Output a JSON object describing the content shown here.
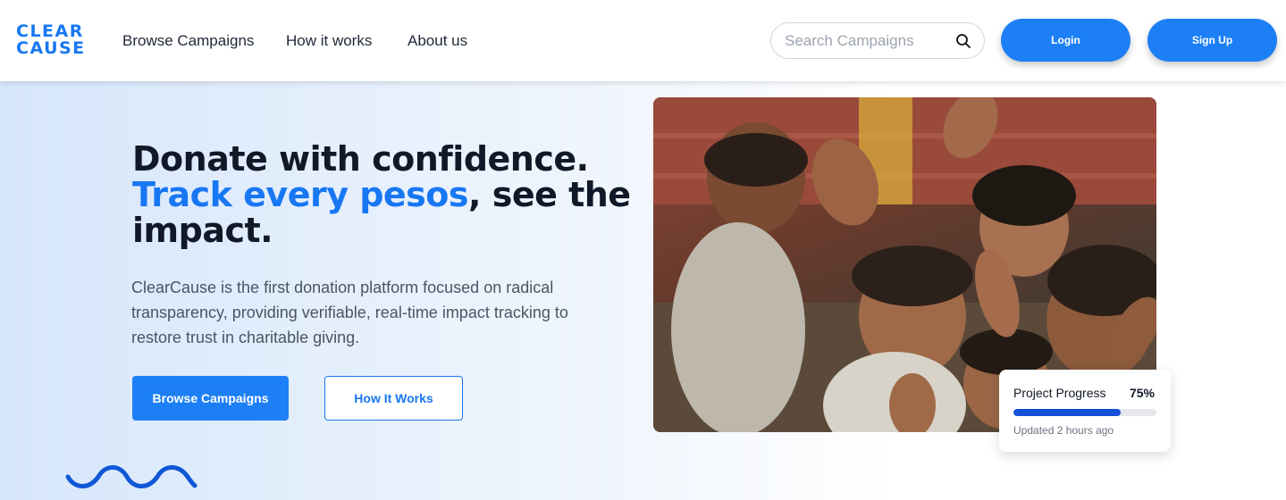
{
  "logo": {
    "line1": "CLEAR",
    "line2": "CAUSE"
  },
  "nav": {
    "browse_campaigns": "Browse Campaigns",
    "how_it_works": "How it works",
    "about_us": "About us"
  },
  "search": {
    "placeholder": "Search Campaigns",
    "value": "",
    "icon": "search-icon"
  },
  "auth": {
    "login_label": "Login",
    "signup_label": "Sign Up"
  },
  "hero": {
    "headline_line1": "Donate with confidence.",
    "headline_accent": "Track every pesos",
    "headline_rest": ", see the impact.",
    "description": "ClearCause is the first donation platform focused on radical transparency, providing verifiable, real-time impact tracking to restore trust in charitable giving.",
    "primary_cta": "Browse Campaigns",
    "secondary_cta": "How It Works"
  },
  "progress_card": {
    "title": "Project Progress",
    "percent_label": "75%",
    "fraction": 0.75,
    "updated": "Updated 2 hours ago"
  },
  "colors": {
    "brand": "#1877f2",
    "button": "#1d7ff5",
    "progress_fill": "#1450d8"
  }
}
